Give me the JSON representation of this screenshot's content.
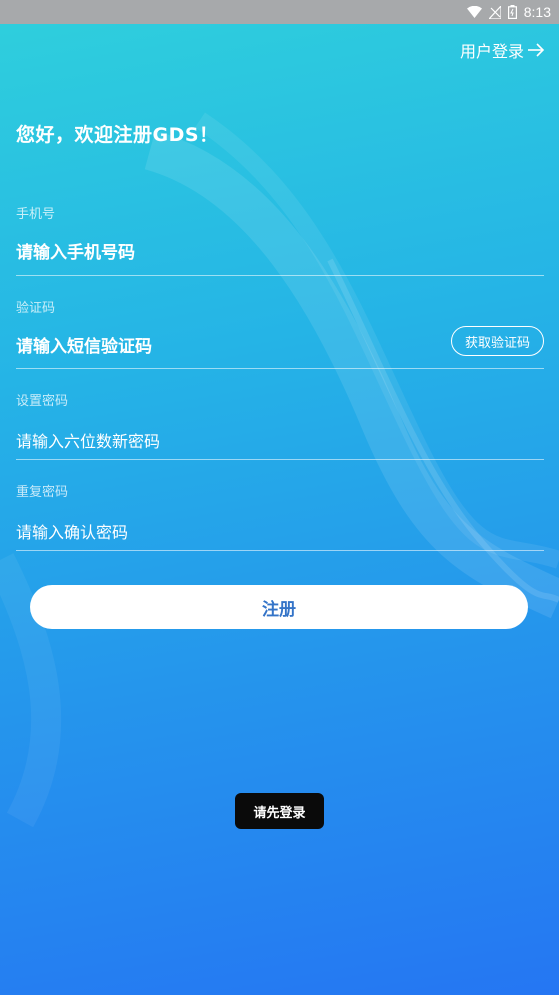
{
  "status_bar": {
    "time": "8:13",
    "icons": [
      "wifi-icon",
      "no-signal-icon",
      "battery-icon"
    ]
  },
  "header": {
    "login_link": "用户登录",
    "login_link_icon": "arrow-right-icon"
  },
  "welcome": "您好，欢迎注册GDS！",
  "form": {
    "phone": {
      "label": "手机号",
      "placeholder": "请输入手机号码"
    },
    "code": {
      "label": "验证码",
      "placeholder": "请输入短信验证码",
      "button": "获取验证码"
    },
    "password": {
      "label": "设置密码",
      "placeholder": "请输入六位数新密码"
    },
    "confirm": {
      "label": "重复密码",
      "placeholder": "请输入确认密码"
    }
  },
  "register_button": "注册",
  "toast": "请先登录",
  "colors": {
    "gradient_top": "#2fd0dc",
    "gradient_bottom": "#2576f3",
    "button_text": "#3474c8",
    "status_bar": "#a7a9ab"
  }
}
